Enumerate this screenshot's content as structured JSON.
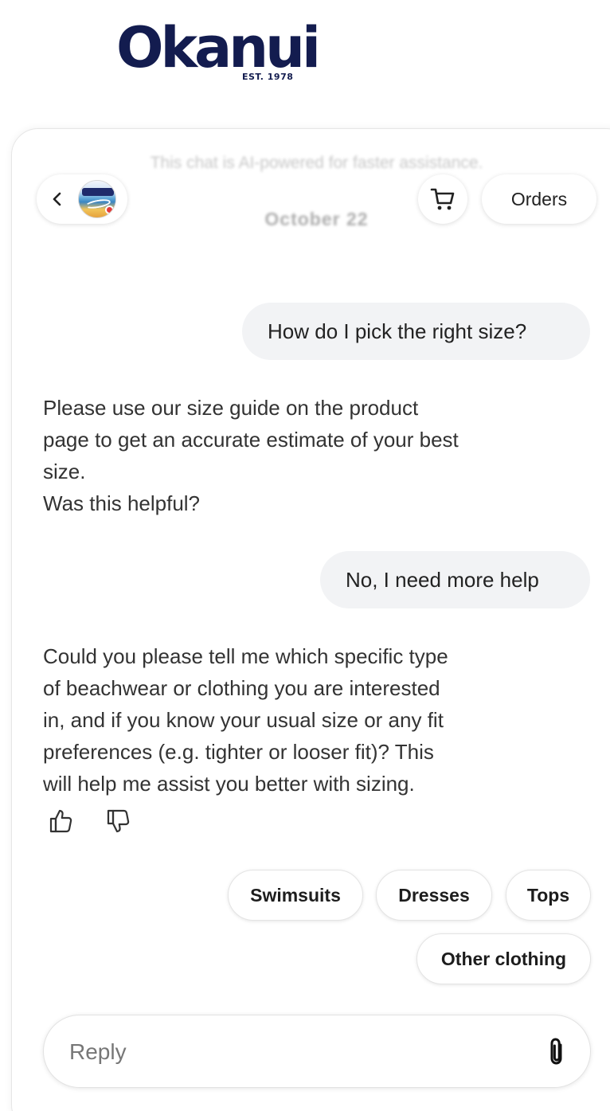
{
  "brand": {
    "name": "Okanui",
    "tagline": "EST. 1978"
  },
  "chat": {
    "notice": "This chat is AI-powered for faster assistance.",
    "date": "October 22"
  },
  "header": {
    "orders_label": "Orders",
    "icons": {
      "back": "chevron-left-icon",
      "cart": "cart-icon"
    }
  },
  "messages": [
    {
      "role": "user",
      "text": "How do I pick the right size?"
    },
    {
      "role": "assistant",
      "lines": [
        "Please use our size guide on the product",
        "page to get an accurate estimate of your best",
        "size.",
        "Was this helpful?"
      ]
    },
    {
      "role": "user",
      "text": "No, I need more help"
    },
    {
      "role": "assistant",
      "lines": [
        "Could you please tell me which specific type",
        "of beachwear or clothing you are interested",
        "in, and if you know your usual size or any fit",
        "preferences (e.g. tighter or looser fit)? This",
        "will help me assist you better with sizing."
      ]
    }
  ],
  "quick_replies": [
    "Swimsuits",
    "Dresses",
    "Tops",
    "Other clothing"
  ],
  "composer": {
    "placeholder": "Reply",
    "attach_icon": "paperclip-icon"
  }
}
